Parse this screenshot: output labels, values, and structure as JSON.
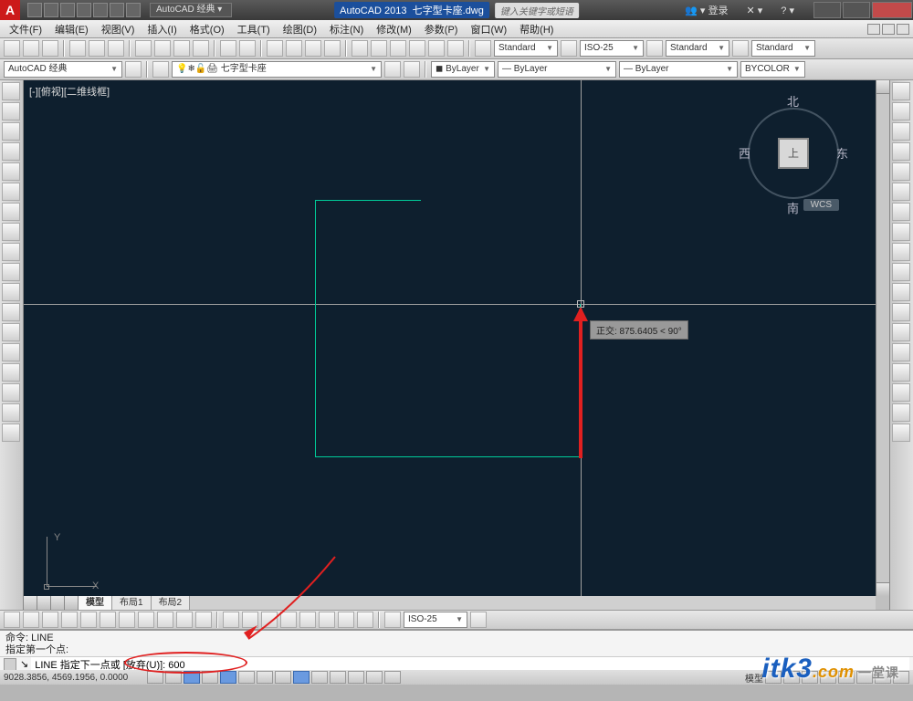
{
  "titlebar": {
    "workspace_select": "AutoCAD 经典",
    "app_name": "AutoCAD 2013",
    "file_name": "七字型卡座.dwg",
    "search_placeholder": "键入关键字或短语",
    "login_label": "登录"
  },
  "menus": [
    "文件(F)",
    "编辑(E)",
    "视图(V)",
    "插入(I)",
    "格式(O)",
    "工具(T)",
    "绘图(D)",
    "标注(N)",
    "修改(M)",
    "参数(P)",
    "窗口(W)",
    "帮助(H)"
  ],
  "toolbar1": {
    "style_combo": "Standard",
    "dimstyle_combo": "ISO-25",
    "tablestyle_combo": "Standard",
    "mleaderstyle_combo": "Standard"
  },
  "toolbar2": {
    "workspace_combo": "AutoCAD 经典",
    "layer_combo": "七字型卡座",
    "linetype_layer": "ByLayer",
    "lineweight": "ByLayer",
    "linetype2": "ByLayer",
    "color": "BYCOLOR"
  },
  "viewport": {
    "label": "[-][俯视][二维线框]"
  },
  "viewcube": {
    "face": "上",
    "north": "北",
    "south": "南",
    "east": "东",
    "west": "西",
    "wcs": "WCS"
  },
  "ucs": {
    "x": "X",
    "y": "Y"
  },
  "ortho_tooltip": "正交: 875.6405 < 90°",
  "layout_tabs": {
    "model": "模型",
    "l1": "布局1",
    "l2": "布局2"
  },
  "dim_toolbar_combo": "ISO-25",
  "command": {
    "hist1": "命令:  LINE",
    "hist2": "指定第一个点:",
    "prompt": "LINE 指定下一点或 [放弃(U)]:  600"
  },
  "status": {
    "coords": "9028.3856, 4569.1956, 0.0000",
    "model_label": "模型"
  },
  "watermark": {
    "main": "itk3",
    "tail": ".com",
    "zh": "一堂课"
  }
}
